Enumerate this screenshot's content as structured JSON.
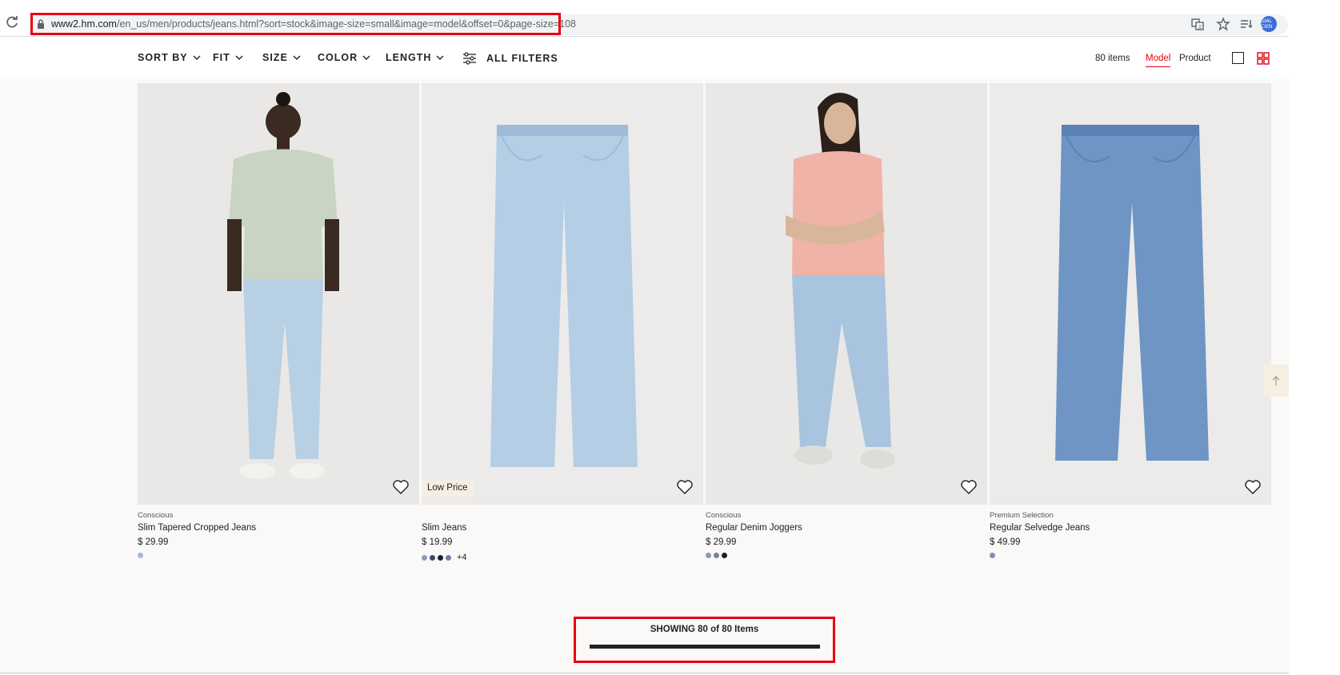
{
  "browser": {
    "url_host": "www2.hm.com",
    "url_path": "/en_us/men/products/jeans.html?sort=stock&image-size=small&image=model&offset=0&page-size=108",
    "avatar_text": "GIAL CIEN"
  },
  "filters": [
    {
      "label": "SORT BY"
    },
    {
      "label": "FIT"
    },
    {
      "label": "SIZE"
    },
    {
      "label": "COLOR"
    },
    {
      "label": "LENGTH"
    },
    {
      "label": "ALL FILTERS"
    }
  ],
  "toolbar": {
    "items_count": "80 items",
    "view_model": "Model",
    "view_product": "Product"
  },
  "products": [
    {
      "label": "Conscious",
      "title": "Slim Tapered Cropped Jeans",
      "price": "$ 29.99",
      "tag": "",
      "swatches": [
        "#a8b6e0"
      ],
      "more": ""
    },
    {
      "label": "",
      "title": "Slim Jeans",
      "price": "$ 19.99",
      "tag": "Low Price",
      "swatches": [
        "#8a9bbf",
        "#3c4a6b",
        "#1f2230",
        "#6f7fa6"
      ],
      "more": "+4"
    },
    {
      "label": "Conscious",
      "title": "Regular Denim Joggers",
      "price": "$ 29.99",
      "tag": "",
      "swatches": [
        "#8a9bbf",
        "#7b8290",
        "#1f1f1f"
      ],
      "more": ""
    },
    {
      "label": "Premium Selection",
      "title": "Regular Selvedge Jeans",
      "price": "$ 49.99",
      "tag": "",
      "swatches": [
        "#7e8fb3"
      ],
      "more": ""
    }
  ],
  "footer": {
    "showing_text": "SHOWING 80 of 80 Items",
    "progress": 1.0
  },
  "colors": {
    "accent_red": "#e50010",
    "highlight_red": "#e8000e"
  }
}
